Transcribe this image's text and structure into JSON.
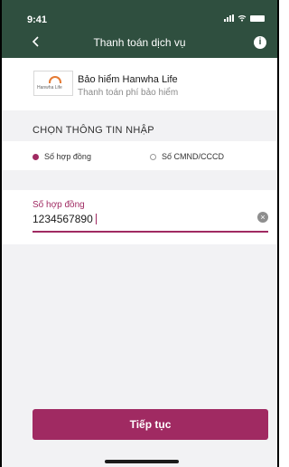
{
  "status_bar": {
    "time": "9:41"
  },
  "header": {
    "title": "Thanh toán dịch vụ"
  },
  "provider": {
    "name": "Bảo hiểm Hanwha Life",
    "subtitle": "Thanh toán phí bảo hiểm",
    "logo_text": "Hanwha Life"
  },
  "section": {
    "title": "CHỌN THÔNG TIN NHẬP"
  },
  "options": [
    {
      "label": "Số hợp đồng",
      "selected": true
    },
    {
      "label": "Số CMND/CCCD",
      "selected": false
    }
  ],
  "input": {
    "label": "Số hợp đồng",
    "value": "1234567890"
  },
  "actions": {
    "continue_label": "Tiếp tục"
  },
  "colors": {
    "header": "#2f4f3f",
    "accent": "#a02a62"
  }
}
